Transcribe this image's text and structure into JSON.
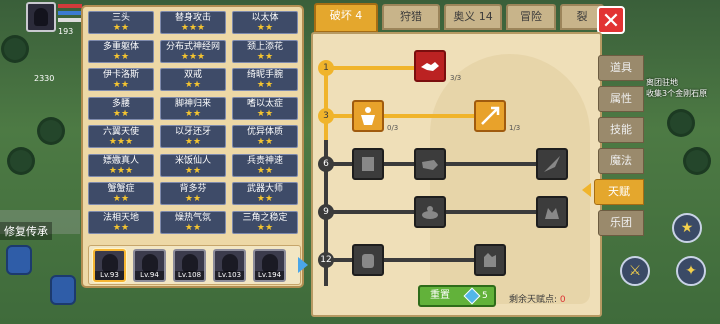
{
  "hud": {
    "labels": [
      "HP",
      "MP",
      "SP"
    ],
    "level": "193",
    "gold": "2330",
    "restore_text": "修复传承"
  },
  "talents": [
    {
      "name": "三头",
      "stars": "★★"
    },
    {
      "name": "替身攻击",
      "stars": "★★★"
    },
    {
      "name": "以太体",
      "stars": "★★"
    },
    {
      "name": "多重躯体",
      "stars": "★★"
    },
    {
      "name": "分布式神经网",
      "stars": "★★★"
    },
    {
      "name": "颈上添花",
      "stars": "★★"
    },
    {
      "name": "伊卡洛斯",
      "stars": "★★"
    },
    {
      "name": "双戒",
      "stars": "★★"
    },
    {
      "name": "绮昵手腕",
      "stars": "★★"
    },
    {
      "name": "多腰",
      "stars": "★★"
    },
    {
      "name": "脚神归来",
      "stars": "★★"
    },
    {
      "name": "嗜以太症",
      "stars": "★★"
    },
    {
      "name": "六翼天使",
      "stars": "★★★"
    },
    {
      "name": "以牙还牙",
      "stars": "★★"
    },
    {
      "name": "优异体质",
      "stars": "★★"
    },
    {
      "name": "嫖嫐真人",
      "stars": "★★★"
    },
    {
      "name": "米饭仙人",
      "stars": "★★"
    },
    {
      "name": "兵贵神速",
      "stars": "★★"
    },
    {
      "name": "蟹蟹症",
      "stars": "★★"
    },
    {
      "name": "背多芬",
      "stars": "★★"
    },
    {
      "name": "武器大师",
      "stars": "★★"
    },
    {
      "name": "法相天地",
      "stars": "★★"
    },
    {
      "name": "燥热气氛",
      "stars": "★★"
    },
    {
      "name": "三角之稳定",
      "stars": "★★"
    }
  ],
  "heroes": [
    {
      "level": "Lv.93",
      "selected": true
    },
    {
      "level": "Lv.94",
      "selected": false
    },
    {
      "level": "Lv.108",
      "selected": false
    },
    {
      "level": "Lv.103",
      "selected": false
    },
    {
      "level": "Lv.194",
      "selected": false
    }
  ],
  "tabs": [
    "破坏 4",
    "狩猎",
    "奥义 14",
    "冒险",
    "裂"
  ],
  "tree": {
    "tiers": [
      "1",
      "3",
      "6",
      "9",
      "12"
    ],
    "counts": [
      "3/3",
      "0/3",
      "1/3"
    ],
    "skills": [
      "handshake-icon",
      "muscle-icon",
      "arrow-icon",
      "dark-skill-1",
      "fist-icon",
      "dark-skill-2",
      "dark-skill-3",
      "dark-skill-4",
      "fist-raise-icon",
      "hand-grab-icon"
    ]
  },
  "reset": {
    "label": "重置",
    "cost": "5"
  },
  "remain": {
    "label": "剩余天赋点:",
    "value": "0"
  },
  "side_menu": [
    "道具",
    "属性",
    "技能",
    "魔法",
    "天赋",
    "乐团"
  ],
  "side_active": "天赋",
  "quest_text": [
    "离团驻地",
    "收集3个金刚石原"
  ],
  "colors": {
    "accent": "#e4a72d",
    "panel": "#edd8a6",
    "cell": "#3e4b68",
    "reset": "#62b23a"
  }
}
